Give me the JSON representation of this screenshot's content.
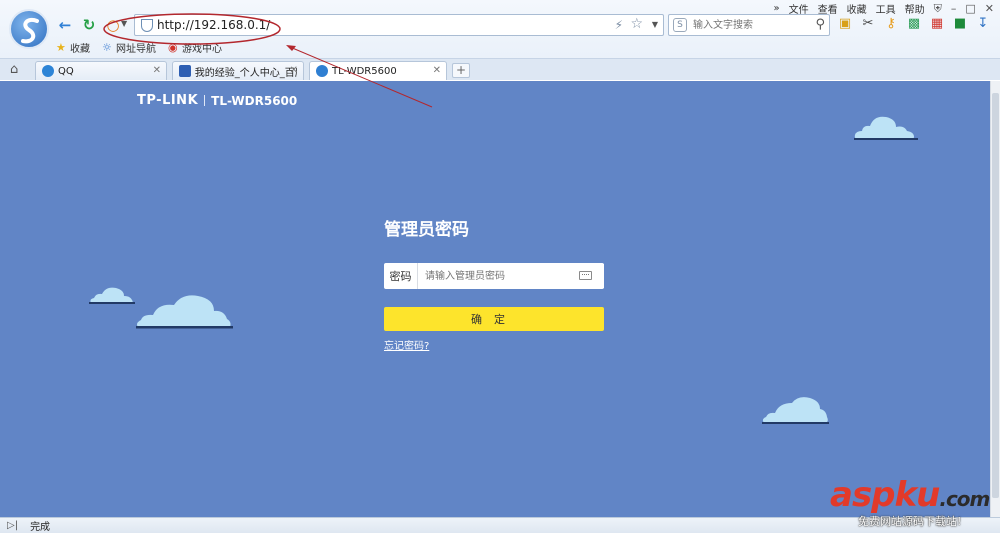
{
  "browser": {
    "top_menu": [
      "文件",
      "查看",
      "收藏",
      "工具",
      "帮助"
    ],
    "url": "http://192.168.0.1/",
    "search_placeholder": "输入文字搜索",
    "bookmarks": [
      "收藏",
      "网址导航",
      "游戏中心"
    ],
    "tabs": [
      {
        "title": "QQ",
        "active": false
      },
      {
        "title": "我的经验_个人中心_百度",
        "active": false
      },
      {
        "title": "TL-WDR5600",
        "active": true
      }
    ],
    "status_text": "完成"
  },
  "page": {
    "brand_logo": "TP-LINK",
    "brand_model": "TL-WDR5600",
    "login_title": "管理员密码",
    "password_label": "密码",
    "password_placeholder": "请输入管理员密码",
    "confirm_label": "确定",
    "forgot_link": "忘记密码?",
    "background_color": "#6185c6",
    "button_color": "#fde42c"
  },
  "annotation": {
    "type": "red ellipse around address bar with arrow",
    "color": "#b3272d"
  },
  "watermark": {
    "logo": "aspku",
    "domain_suffix": ".com",
    "subtitle": "免费网站源码下载站!"
  }
}
